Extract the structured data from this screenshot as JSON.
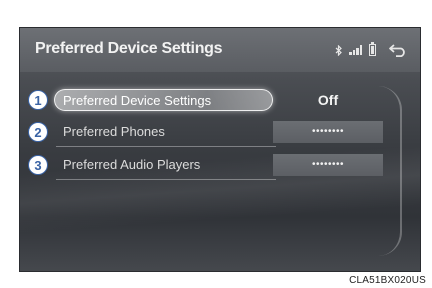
{
  "header": {
    "title": "Preferred Device Settings",
    "status_icons": [
      "bluetooth-icon",
      "signal-icon",
      "battery-icon",
      "back-icon"
    ]
  },
  "rows": [
    {
      "number": "1",
      "label": "Preferred Device Settings",
      "value": "Off"
    },
    {
      "number": "2",
      "label": "Preferred Phones",
      "value": "••••••••"
    },
    {
      "number": "3",
      "label": "Preferred Audio Players",
      "value": "••••••••"
    }
  ],
  "caption": "CLA51BX020US"
}
